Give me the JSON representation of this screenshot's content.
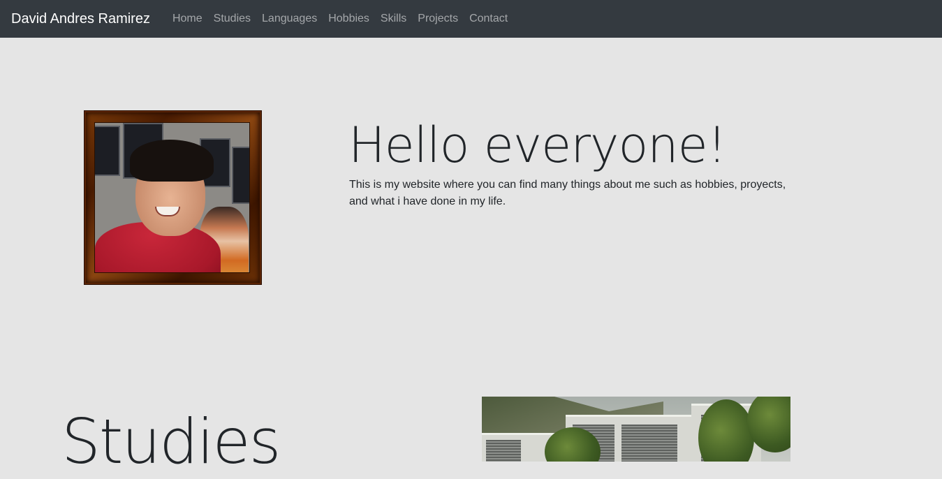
{
  "navbar": {
    "brand": "David Andres Ramirez",
    "links": [
      {
        "label": "Home"
      },
      {
        "label": "Studies"
      },
      {
        "label": "Languages"
      },
      {
        "label": "Hobbies"
      },
      {
        "label": "Skills"
      },
      {
        "label": "Projects"
      },
      {
        "label": "Contact"
      }
    ]
  },
  "hero": {
    "title": "Hello everyone!",
    "text": "This is my website where you can find many things about me such as hobbies, proyects, and what i have done in my life."
  },
  "studies": {
    "title": "Studies"
  },
  "colors": {
    "navbar_bg": "#343a40",
    "page_bg": "#e5e5e5",
    "frame": "#6e3206"
  }
}
